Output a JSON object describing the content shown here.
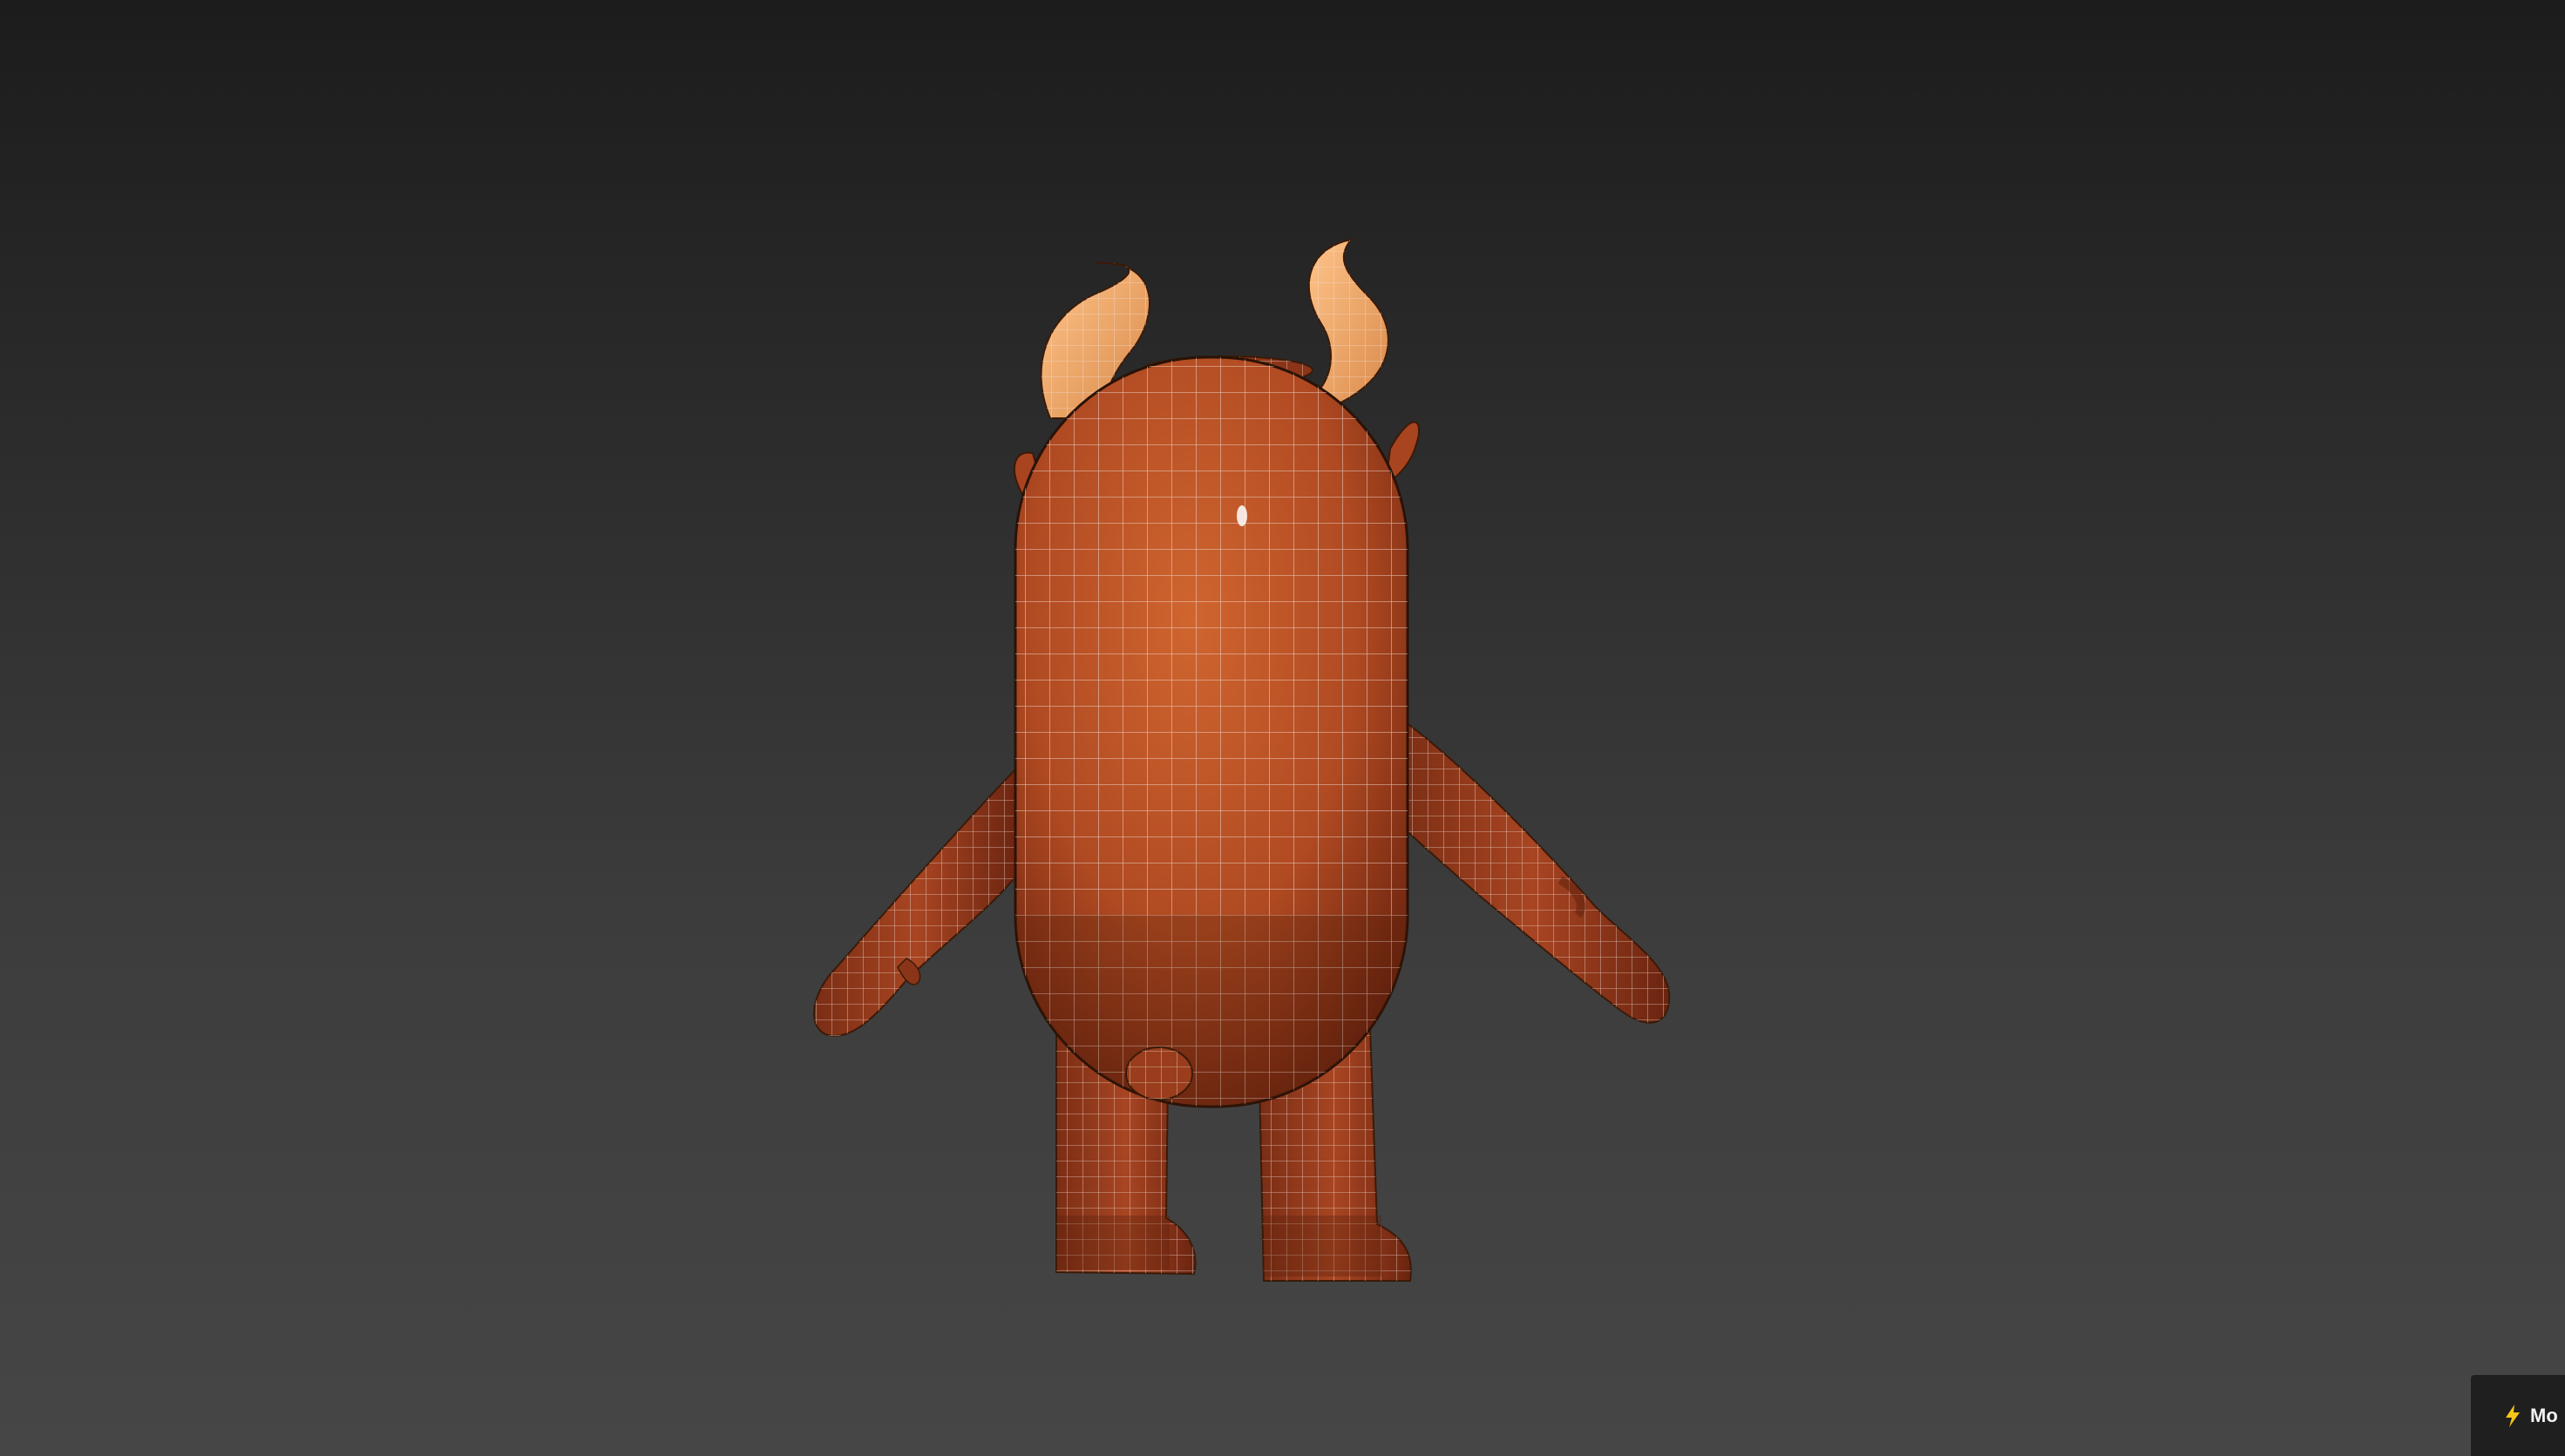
{
  "viewport": {
    "background_top": "#1c1c1c",
    "background_bottom": "#464646",
    "model_colors": {
      "body": "#b8502a",
      "body_shadow": "#7a2d14",
      "horn": "#f0a868",
      "wire": "#e8d8d0"
    }
  },
  "corner_badge": {
    "icon": "lightning-bolt-icon",
    "label": "Mo",
    "accent": "#f5c518"
  }
}
